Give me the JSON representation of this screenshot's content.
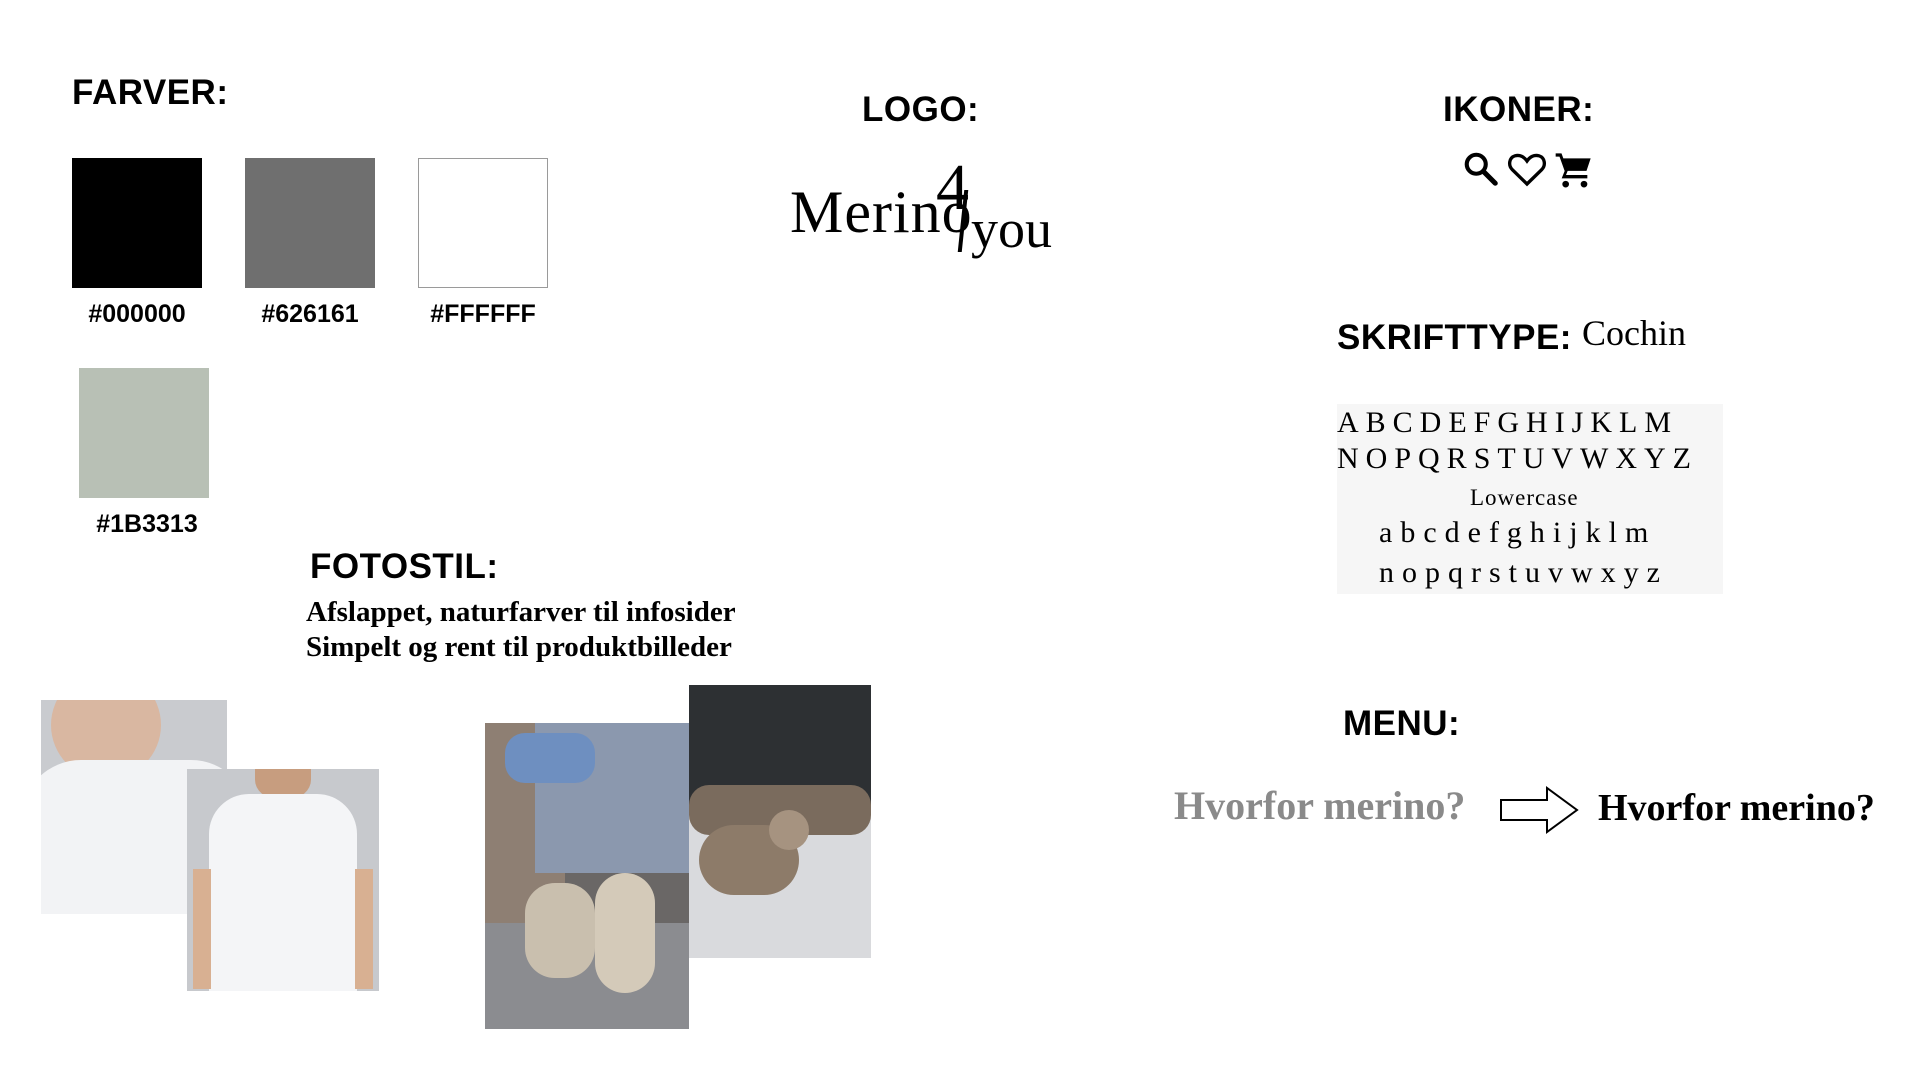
{
  "colors": {
    "heading": "FARVER:",
    "swatches": [
      {
        "hex": "#000000",
        "label": "#000000"
      },
      {
        "hex": "#6f6f6f",
        "label": "#626161"
      },
      {
        "hex": "#FFFFFF",
        "label": "#FFFFFF"
      },
      {
        "hex": "#b8c0b5",
        "label": "#1B3313"
      }
    ]
  },
  "logo": {
    "heading": "LOGO:",
    "text_merino": "Merino",
    "text_four": "4",
    "text_you": "you"
  },
  "icons": {
    "heading": "IKONER:",
    "items": [
      "search-icon",
      "heart-icon",
      "cart-icon"
    ]
  },
  "typography": {
    "heading": "SKRIFTTYPE:",
    "font_name": "Cochin",
    "uppercase_row1": "ABCDEFGHIJKLM",
    "uppercase_row2": "NOPQRSTUVWXYZ",
    "lowercase_label": "Lowercase",
    "lowercase_row1": "abcdefghijklm",
    "lowercase_row2": "nopqrstuvwxyz"
  },
  "photo_style": {
    "heading": "FOTOSTIL:",
    "line1": "Afslappet, naturfarver til infosider",
    "line2": "Simpelt og rent til produktbilleder"
  },
  "menu": {
    "heading": "MENU:",
    "inactive_label": "Hvorfor merino?",
    "active_label": "Hvorfor merino?",
    "inactive_color": "#8a8a8a"
  }
}
